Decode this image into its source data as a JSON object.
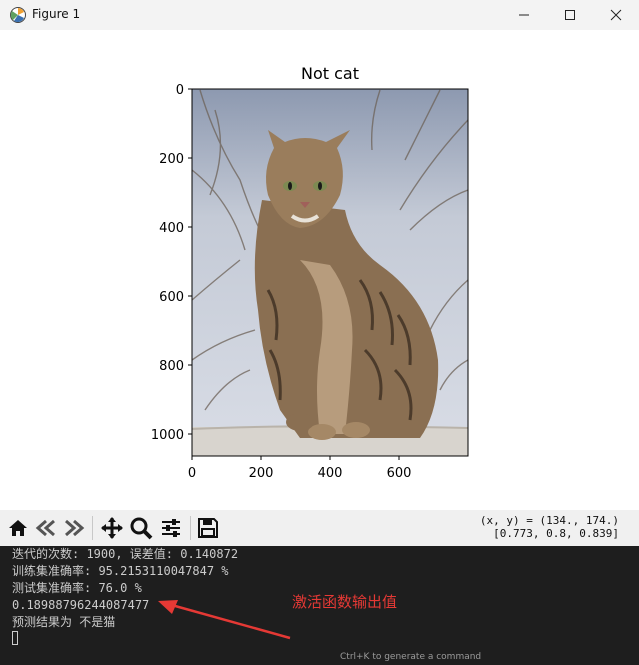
{
  "window": {
    "title": "Figure 1"
  },
  "plot": {
    "title": "Not cat",
    "y_ticks": [
      "0",
      "200",
      "400",
      "600",
      "800",
      "1000"
    ],
    "x_ticks": [
      "0",
      "200",
      "400",
      "600"
    ]
  },
  "toolbar": {
    "icons": [
      "home-icon",
      "back-icon",
      "forward-icon",
      "pan-icon",
      "zoom-icon",
      "configure-subplots-icon",
      "save-icon"
    ],
    "coord_line1": "(x, y) = (134., 174.)",
    "coord_line2": "[0.773, 0.8, 0.839]"
  },
  "terminal": {
    "lines": [
      "迭代的次数: 1900, 误差值: 0.140872",
      "训练集准确率: 95.2153110047847 %",
      "测试集准确率: 76.0 %",
      "0.18988796244087477",
      "预测结果为 不是猫"
    ],
    "annotation": "激活函数输出值",
    "hint": "Ctrl+K to generate a command"
  },
  "colors": {
    "annotation": "#e53935",
    "terminal_bg": "#1e1e1e",
    "terminal_text": "#cccccc"
  }
}
